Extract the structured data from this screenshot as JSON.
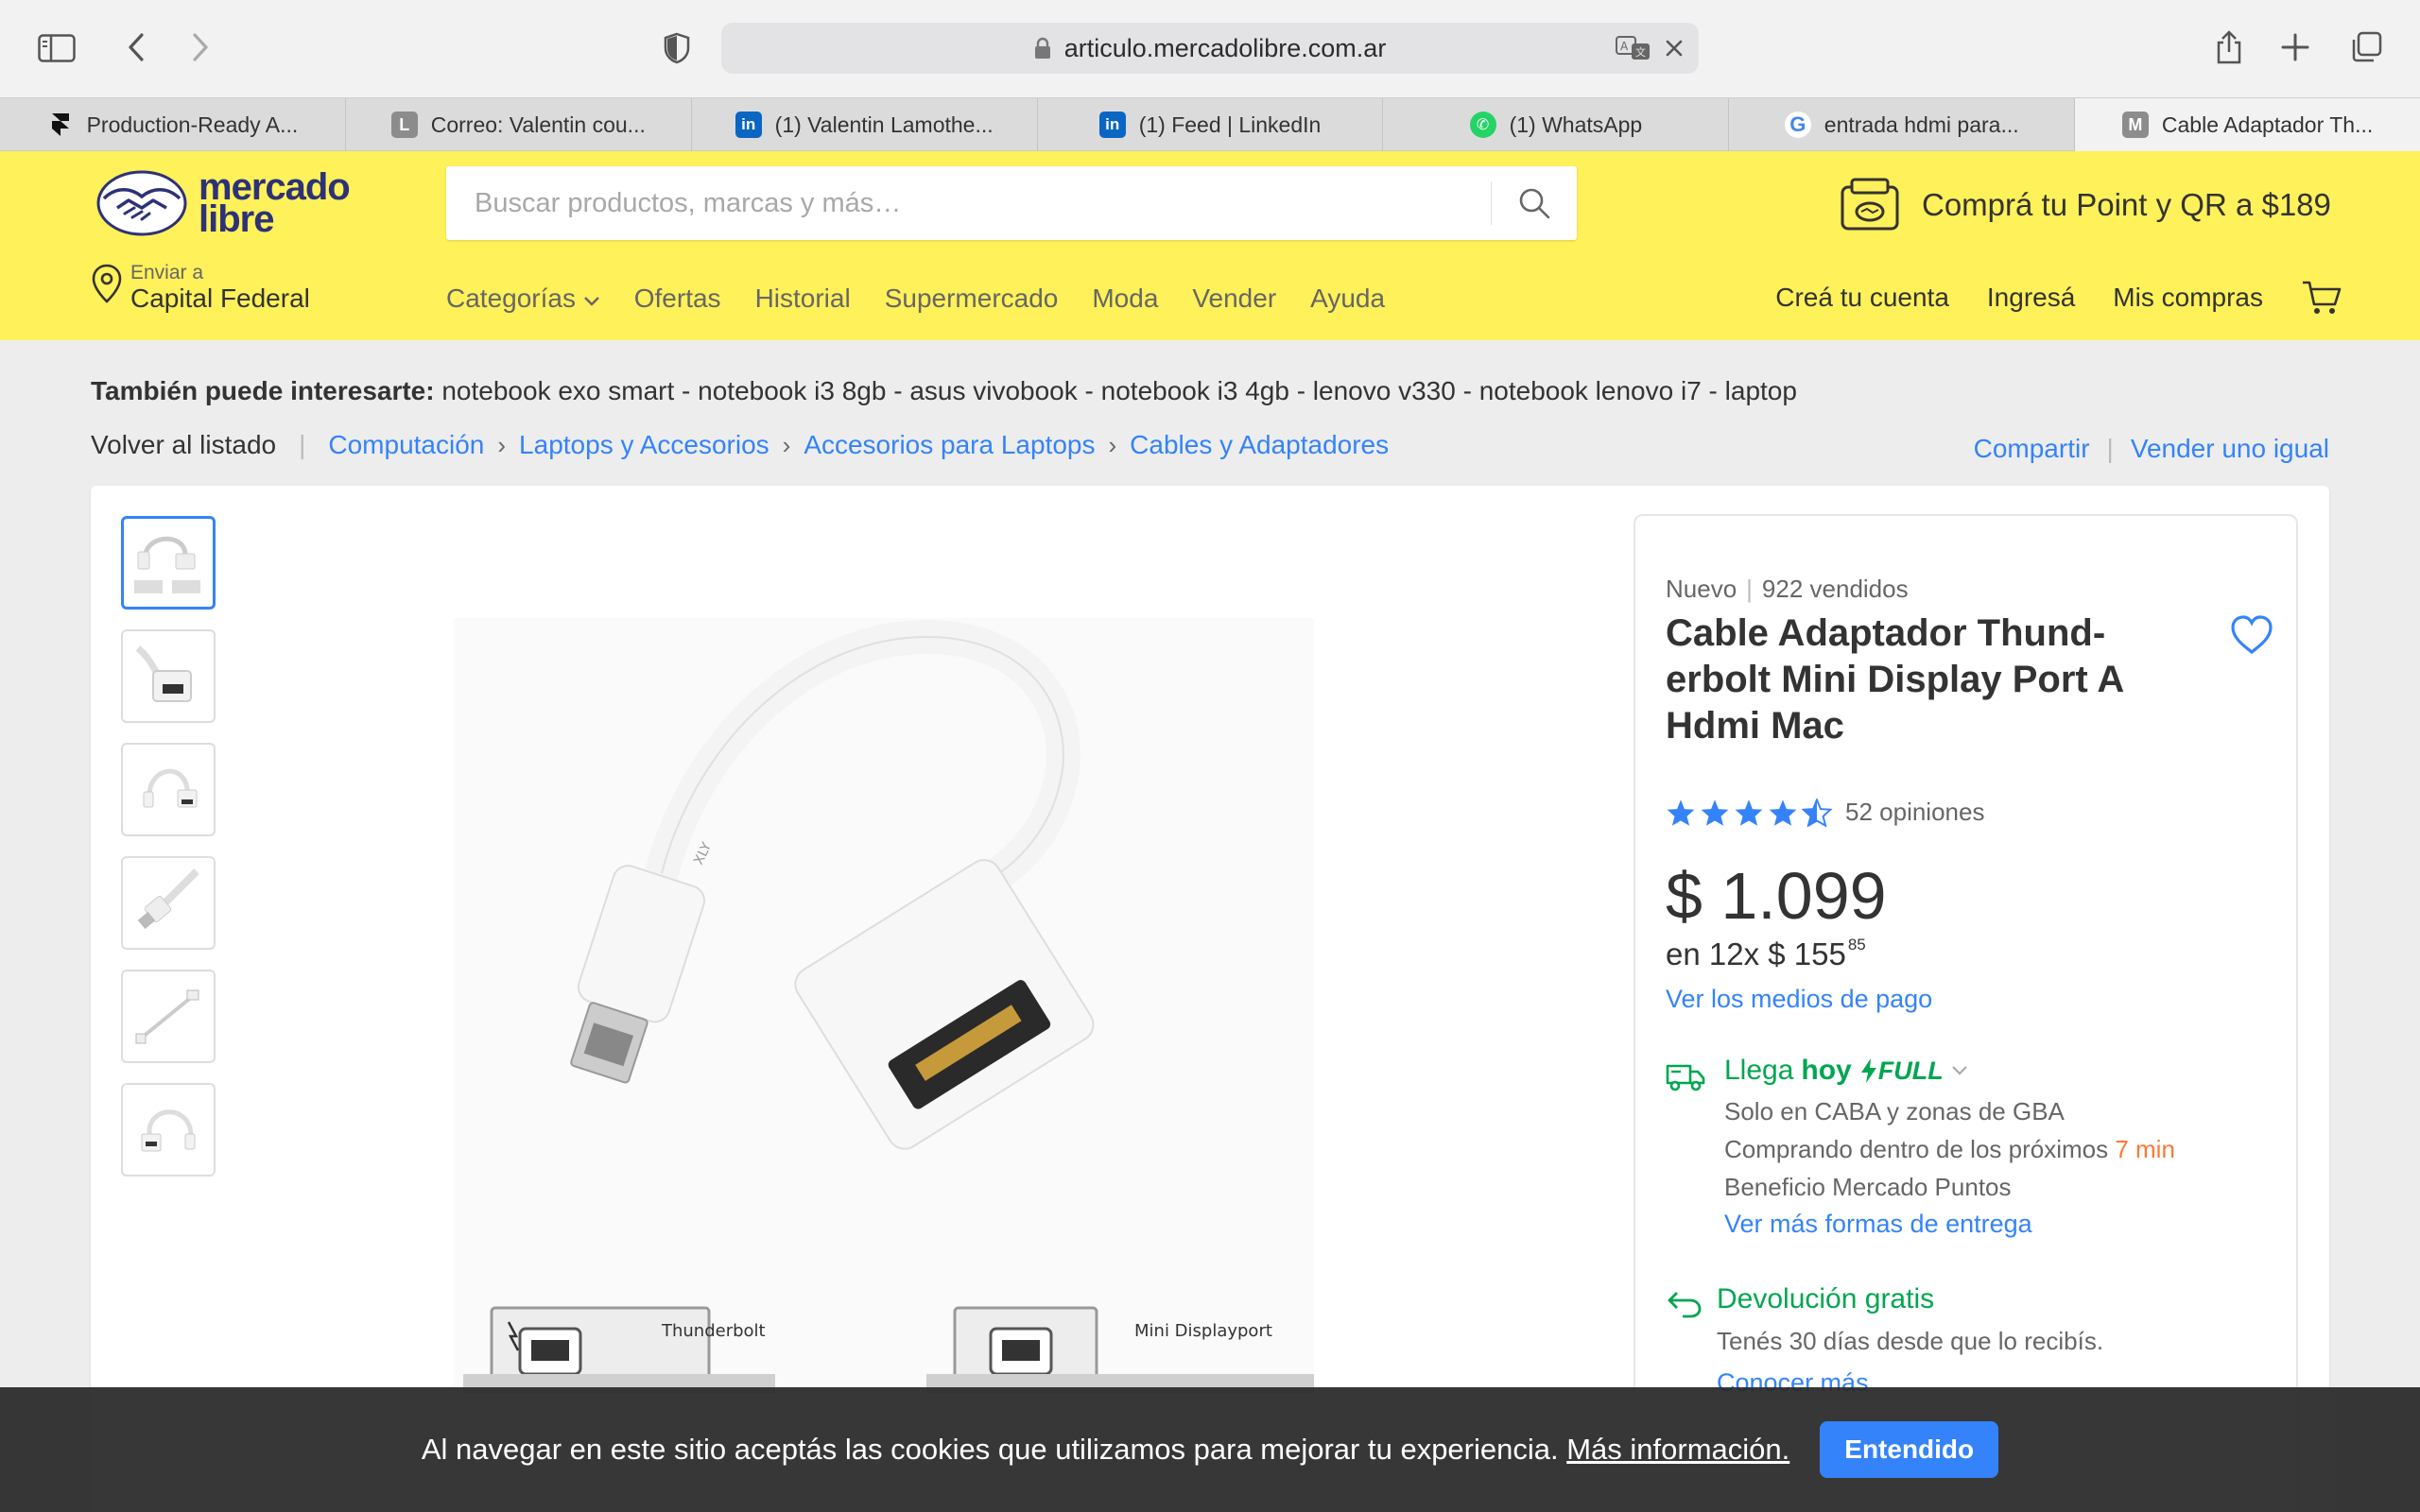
{
  "browser": {
    "url": "articulo.mercadolibre.com.ar",
    "tabs": [
      {
        "title": "Production-Ready A...",
        "icon": "framer-icon",
        "color": "#111111",
        "glyph": "F"
      },
      {
        "title": "Correo: Valentin cou...",
        "icon": "letter-l-icon",
        "color": "#8c8c8c",
        "glyph": "L"
      },
      {
        "title": "(1) Valentin Lamothe...",
        "icon": "linkedin-icon",
        "color": "#0a66c2",
        "glyph": "in"
      },
      {
        "title": "(1) Feed | LinkedIn",
        "icon": "linkedin-icon",
        "color": "#0a66c2",
        "glyph": "in"
      },
      {
        "title": "(1) WhatsApp",
        "icon": "whatsapp-icon",
        "color": "#25d366",
        "glyph": "✆"
      },
      {
        "title": "entrada hdmi para...",
        "icon": "google-icon",
        "color": "#4285f4",
        "glyph": "G"
      },
      {
        "title": "Cable Adaptador Th...",
        "icon": "letter-m-icon",
        "color": "#8c8c8c",
        "glyph": "M"
      }
    ],
    "active_tab": 6
  },
  "header": {
    "logo_line1": "mercado",
    "logo_line2": "libre",
    "search_placeholder": "Buscar productos, marcas y más…",
    "promo": "Comprá tu Point y QR a $189",
    "ship_label": "Enviar a",
    "ship_location": "Capital Federal",
    "nav": [
      "Categorías",
      "Ofertas",
      "Historial",
      "Supermercado",
      "Moda",
      "Vender",
      "Ayuda"
    ],
    "user_nav": [
      "Creá tu cuenta",
      "Ingresá",
      "Mis compras"
    ],
    "brand_color": "#fff159"
  },
  "related": {
    "label": "También puede interesarte:",
    "items": "notebook exo smart - notebook i3 8gb - asus vivobook - notebook i3 4gb - lenovo v330 - notebook lenovo i7 - laptop"
  },
  "breadcrumb": {
    "back": "Volver al listado",
    "items": [
      "Computación",
      "Laptops y Accesorios",
      "Accesorios para Laptops",
      "Cables y Adaptadores"
    ],
    "share": "Compartir",
    "sell": "Vender uno igual"
  },
  "product": {
    "condition": "Nuevo",
    "sold": "922 vendidos",
    "title": "Cable Adaptador Thund-erbolt Mini Display Port A Hdmi Mac",
    "rating": 4.5,
    "reviews": "52 opiniones",
    "price": "$ 1.099",
    "installments_prefix": "en 12x $ 155",
    "installments_cents": "85",
    "payment_link": "Ver los medios de pago",
    "image_labels": {
      "left": "Thunderbolt",
      "right": "Mini Displayport"
    },
    "accent_color": "#3483fa"
  },
  "delivery": {
    "arrives": "Llega",
    "when": "hoy",
    "full": "FULL",
    "line1": "Solo en CABA y zonas de GBA",
    "line2": "Comprando dentro de los próximos",
    "time": "7 min",
    "line3": "Beneficio Mercado Puntos",
    "link": "Ver más formas de entrega",
    "color": "#00a650"
  },
  "returns": {
    "title": "Devolución gratis",
    "text": "Tenés 30 días desde que lo recibís.",
    "link": "Conocer más"
  },
  "cookie": {
    "text": "Al navegar en este sitio aceptás las cookies que utilizamos para mejorar tu experiencia.",
    "link": "Más información.",
    "button": "Entendido"
  }
}
